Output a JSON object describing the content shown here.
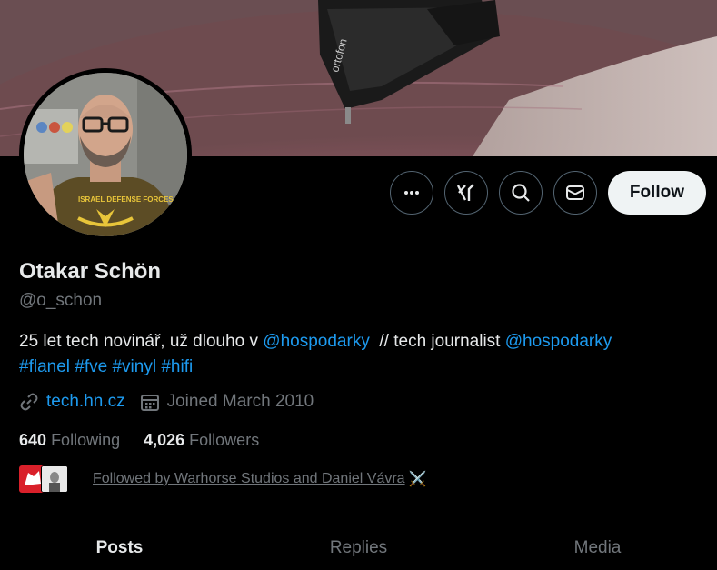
{
  "profile": {
    "name": "Otakar Schön",
    "handle": "@o_schon",
    "bio": {
      "part1": "25 let tech novinář, už dlouho v ",
      "mention1": "@hospodarky",
      "part2": "  // tech journalist ",
      "mention2": "@hospodarky",
      "hashtags": [
        "#flanel",
        "#fve",
        "#vinyl",
        "#hifi"
      ]
    },
    "website": "tech.hn.cz",
    "joined": "Joined March 2010"
  },
  "stats": {
    "following_count": "640",
    "following_label": "Following",
    "followers_count": "4,026",
    "followers_label": "Followers"
  },
  "followed_by": {
    "text": "Followed by Warhorse Studios and Daniel Vávra",
    "emoji": "⚔️"
  },
  "actions": {
    "follow_label": "Follow"
  },
  "tabs": [
    {
      "label": "Posts",
      "active": true
    },
    {
      "label": "Replies",
      "active": false
    },
    {
      "label": "Media",
      "active": false
    }
  ],
  "banner": {
    "cartridge_text": "ortofon"
  },
  "avatar": {
    "shirt_text": "ISRAEL DEFENSE FORCES"
  },
  "icons": {
    "more": "more-icon",
    "grok": "grok-icon",
    "search": "search-icon",
    "message": "mail-icon",
    "link": "link-icon",
    "calendar": "calendar-icon"
  },
  "colors": {
    "background": "#000000",
    "text": "#e7e9ea",
    "secondary": "#71767b",
    "link": "#1d9bf0",
    "follow_button": "#eff3f4"
  }
}
